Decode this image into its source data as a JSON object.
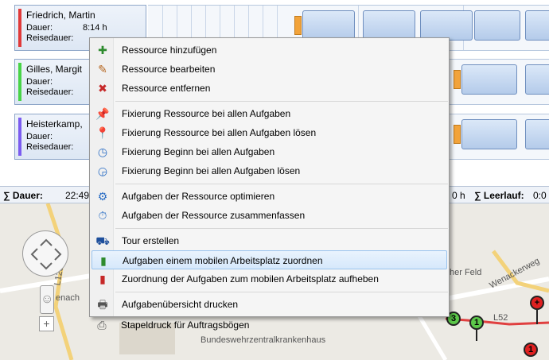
{
  "resources": [
    {
      "name": "Friedrich, Martin",
      "duration_label": "Dauer:",
      "duration": "8:14 h",
      "travel_label": "Reisedauer:",
      "color": "#e03a3a"
    },
    {
      "name": "Gilles, Margit",
      "duration_label": "Dauer:",
      "duration": "",
      "travel_label": "Reisedauer:",
      "color": "#48d448"
    },
    {
      "name": "Heisterkamp,",
      "duration_label": "Dauer:",
      "duration": "",
      "travel_label": "Reisedauer:",
      "color": "#7b5cf0"
    }
  ],
  "statusbar": {
    "sum_duration_label": "∑ Dauer:",
    "sum_duration_value": "22:49",
    "mid_fragment": "0 h",
    "idle_label": "∑ Leerlauf:",
    "idle_value": "0:0"
  },
  "context_menu": {
    "items": [
      {
        "label": "Ressource hinzufügen",
        "icon": "resource-add-icon"
      },
      {
        "label": "Ressource bearbeiten",
        "icon": "resource-edit-icon"
      },
      {
        "label": "Ressource entfernen",
        "icon": "resource-remove-icon"
      },
      {
        "label": "Fixierung Ressource bei allen Aufgaben",
        "icon": "resource-pin-icon"
      },
      {
        "label": "Fixierung Ressource bei allen Aufgaben lösen",
        "icon": "resource-unpin-icon"
      },
      {
        "label": "Fixierung Beginn bei allen Aufgaben",
        "icon": "clock-pin-icon"
      },
      {
        "label": "Fixierung Beginn bei allen Aufgaben lösen",
        "icon": "clock-unpin-icon"
      },
      {
        "label": "Aufgaben der Ressource optimieren",
        "icon": "optimize-icon"
      },
      {
        "label": "Aufgaben der Ressource zusammenfassen",
        "icon": "summarize-clock-icon"
      },
      {
        "label": "Tour erstellen",
        "icon": "tour-icon"
      },
      {
        "label": "Aufgaben einem mobilen Arbeitsplatz zuordnen",
        "icon": "mobile-assign-icon"
      },
      {
        "label": "Zuordnung der Aufgaben zum mobilen Arbeitsplatz aufheben",
        "icon": "mobile-unassign-icon"
      },
      {
        "label": "Aufgabenübersicht drucken",
        "icon": "print-list-icon"
      },
      {
        "label": "Stapeldruck für Auftragsbögen",
        "icon": "batch-print-icon"
      }
    ],
    "highlighted_index": 10
  },
  "map": {
    "labels": [
      "L125",
      "enach",
      "her Feld",
      "Wenackerweg",
      "Bundeswehrzentralkrankenhaus",
      "L52"
    ],
    "pins": [
      {
        "label": "3",
        "color": "#5cc84a"
      },
      {
        "label": "1",
        "color": "#5cc84a"
      },
      {
        "label": "+",
        "color": "#e02020"
      },
      {
        "label": "1",
        "color": "#e02020"
      }
    ]
  },
  "colors": {
    "menu_highlight": "#d6e8fb",
    "task_fill": "#b4cbea",
    "travel_fill": "#f2a33a"
  }
}
